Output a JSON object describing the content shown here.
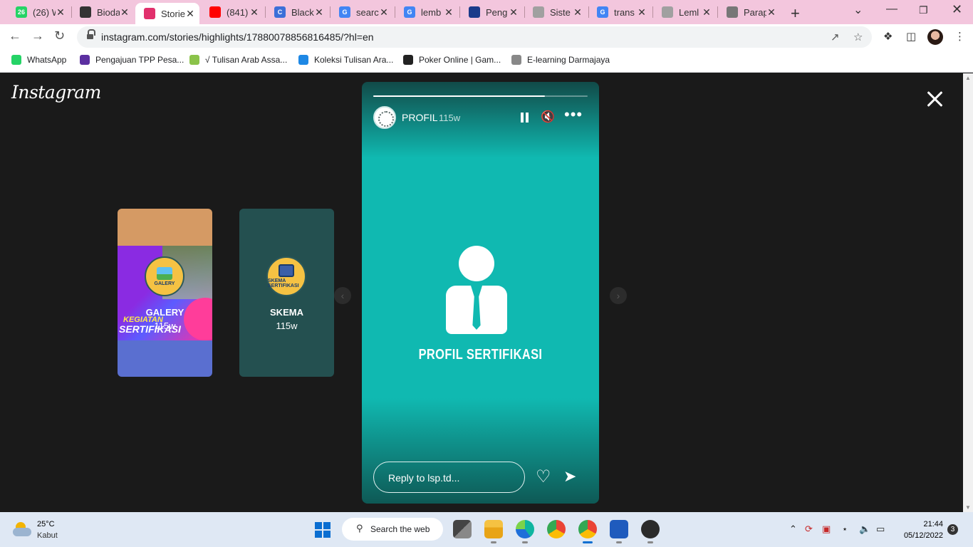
{
  "browser": {
    "tabs": [
      {
        "title": "(26) W",
        "favicon_color": "#25d366",
        "favicon_text": "26"
      },
      {
        "title": "Bioda",
        "favicon_color": "#333333",
        "favicon_text": ""
      },
      {
        "title": "Stories",
        "favicon_color": "#e1306c",
        "favicon_text": "",
        "active": true
      },
      {
        "title": "(841)",
        "favicon_color": "#ff0000",
        "favicon_text": ""
      },
      {
        "title": "Black",
        "favicon_color": "#3b6fd8",
        "favicon_text": "C"
      },
      {
        "title": "searc",
        "favicon_color": "#4285f4",
        "favicon_text": "G"
      },
      {
        "title": "lemb",
        "favicon_color": "#4285f4",
        "favicon_text": "G"
      },
      {
        "title": "Peng",
        "favicon_color": "#1a3b8a",
        "favicon_text": ""
      },
      {
        "title": "Siste",
        "favicon_color": "#a0a0a0",
        "favicon_text": ""
      },
      {
        "title": "trans",
        "favicon_color": "#4285f4",
        "favicon_text": "G"
      },
      {
        "title": "Leml",
        "favicon_color": "#a0a0a0",
        "favicon_text": ""
      },
      {
        "title": "Parap",
        "favicon_color": "#777777",
        "favicon_text": ""
      }
    ],
    "url": "instagram.com/stories/highlights/17880078856816485/?hl=en",
    "bookmarks": [
      {
        "label": "WhatsApp",
        "color": "#25d366"
      },
      {
        "label": "Pengajuan TPP Pesa...",
        "color": "#5b2fa0"
      },
      {
        "label": "√ Tulisan Arab Assa...",
        "color": "#8bc34a"
      },
      {
        "label": "Koleksi Tulisan Ara...",
        "color": "#1e88e5"
      },
      {
        "label": "Poker Online | Gam...",
        "color": "#222222"
      },
      {
        "label": "E-learning Darmajaya",
        "color": "#888888"
      }
    ]
  },
  "instagram": {
    "logo": "Instagram",
    "previews": [
      {
        "name": "GALERY",
        "time": "115w",
        "icon_label": "GALERY",
        "kegiatan": "KEGIATAN",
        "sertifikasi": "SERTIFIKASI"
      },
      {
        "name": "SKEMA",
        "time": "115w",
        "icon_label": "SKEMA SERTIFIKASI"
      }
    ],
    "story": {
      "username": "PROFIL",
      "time": "115w",
      "progress": 0.8,
      "caption": "PROFIL SERTIFIKASI",
      "reply_placeholder": "Reply to lsp.td..."
    }
  },
  "taskbar": {
    "temperature": "25°C",
    "condition": "Kabut",
    "search_label": "Search the web",
    "time": "21:44",
    "date": "05/12/2022",
    "notifications": "3"
  }
}
